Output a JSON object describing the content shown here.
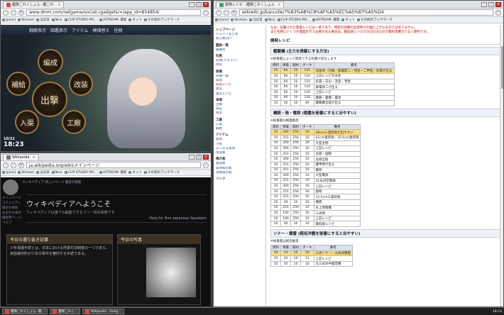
{
  "game_window": {
    "tab": "艦隊これくしょん -艦これ-",
    "url": "www.dmm.com/netgame/social/-/gadgets/=/app_id=854854/",
    "bookmarks": [
      "[pixiv]",
      "Stickam",
      "ほぼ日",
      "Nico",
      "CLIP STUDIO PAI…",
      "USTREAM: 最新",
      "ネット",
      "その他のブックマーク"
    ],
    "menu": [
      "戦績表示",
      "図鑑表示",
      "アイテム",
      "模様替え",
      "任務"
    ],
    "hubs": {
      "center": "出撃",
      "top": "編成",
      "left": "補給",
      "right": "改装",
      "bottom_left": "入渠",
      "bottom_right": "工廠"
    },
    "date": "10/22",
    "time": "18:23"
  },
  "wiki_left_window": {
    "tab": "Wikipedia",
    "url": "ja.wikipedia.org/wiki/メインページ",
    "top_links": "ウィキペディア 新しいページ  最近の更新",
    "welcome": "ウィキペディアへようこそ",
    "welcome_sub": "ウィキペディアは誰でも編集できるフリー百科事典です",
    "help_link": "Help for Non-Japanese Speakers",
    "panel1_title": "今日の選り抜き記事",
    "panel1_text": "少年保護手続とは、日本における刑事司法制度の一つであり、家庭裁判所が少年の事件を審判する手続である。",
    "panel2_title": "今日の写真",
    "side": [
      "メインページ",
      "コミュニティ",
      "最近の更新",
      "おまかせ表示",
      "練習用ページ",
      "ヘルプ"
    ]
  },
  "wiki_right_window": {
    "tab": "開発レシピ - 艦隊これくしょん",
    "url": "wikiwiki.jp/kancolle/?%B3%AB%C8%AF%A5%EC%A5%B7%A5%D4",
    "notice1": "なお、記載された開発レシピは一例であり、特定の装備の出現率が大幅に上がるものではありません。",
    "notice2": "また任務にいくつか開発を行う必要がある場合は、最低値レシピ(10/10/10/10)が資材消費が少なく便利です。",
    "page_title": "開発レシピ",
    "nav": [
      {
        "t": "トップページ",
        "c": "hd"
      },
      {
        "t": "ドロップまとめ",
        "c": "a"
      },
      {
        "t": "初心者向け",
        "c": "a"
      },
      {
        "t": "艦娘一覧",
        "c": "hd"
      },
      {
        "t": "艦種別",
        "c": "a"
      },
      {
        "t": "任務",
        "c": "hd"
      },
      {
        "t": "任務(クエスト)",
        "c": "a"
      },
      {
        "t": "改装",
        "c": "a"
      },
      {
        "t": "装備",
        "c": "hd"
      },
      {
        "t": "装備一覧",
        "c": "a"
      },
      {
        "t": "開発",
        "c": "a"
      },
      {
        "t": "開発レシピ",
        "c": "red"
      },
      {
        "t": "建造",
        "c": "a"
      },
      {
        "t": "建造レシピ",
        "c": "a"
      },
      {
        "t": "海域",
        "c": "hd"
      },
      {
        "t": "出撃",
        "c": "a"
      },
      {
        "t": "遠征",
        "c": "a"
      },
      {
        "t": "演習",
        "c": "a"
      },
      {
        "t": "工廠",
        "c": "hd"
      },
      {
        "t": "入渠",
        "c": "a"
      },
      {
        "t": "補給",
        "c": "a"
      },
      {
        "t": "アイテム",
        "c": "hd"
      },
      {
        "t": "家具",
        "c": "a"
      },
      {
        "t": "小技",
        "c": "a"
      },
      {
        "t": "よくある質問",
        "c": "a"
      },
      {
        "t": "用語集",
        "c": "a"
      },
      {
        "t": "掲示板",
        "c": "hd"
      },
      {
        "t": "雑談板",
        "c": "a"
      },
      {
        "t": "質問掲示板",
        "c": "a"
      },
      {
        "t": "攻略掲示板",
        "c": "a"
      },
      {
        "t": "リンク",
        "c": "hd"
      }
    ],
    "section1": "艦載機 (主力を搭載にする方法)",
    "note1": "※秘書艦によって開発できる装備が変化します",
    "headers": [
      "燃料",
      "弾薬",
      "鋼材",
      "ボーキ",
      "備考"
    ],
    "table1": [
      {
        "v": [
          "20",
          "60",
          "10",
          "110"
        ],
        "note": "流星改・烈風・紫電改二・彗星一二甲型・彩雲が出る",
        "hl": true
      },
      {
        "v": [
          "20",
          "60",
          "10",
          "110"
        ],
        "note": "上記レシピの派生",
        "hl": false
      },
      {
        "v": [
          "20",
          "60",
          "10",
          "110"
        ],
        "note": "彩雲・天山・流星・彗星",
        "hl": false
      },
      {
        "v": [
          "20",
          "60",
          "10",
          "110"
        ],
        "note": "紫電改二が出る",
        "hl": false
      },
      {
        "v": [
          "20",
          "60",
          "10",
          "110"
        ],
        "note": "上記レシピ",
        "hl": false
      },
      {
        "v": [
          "30",
          "60",
          "10",
          "120"
        ],
        "note": "艦戦・艦爆・艦攻",
        "hl": false
      },
      {
        "v": [
          "10",
          "30",
          "10",
          "40"
        ],
        "note": "艦載機全般が出る",
        "hl": false
      }
    ],
    "section2": "機銃・砲・電探 (戦艦を秘書にすると出やすい)",
    "note2": "※秘書艦は戦艦推奨",
    "table2": [
      {
        "v": [
          "10",
          "300",
          "250",
          "10"
        ],
        "note": "46cm三連装砲が出やすい",
        "hl": true
      },
      {
        "v": [
          "10",
          "251",
          "250",
          "10"
        ],
        "note": "41cm連装砲・35.6cm連装砲",
        "hl": false
      },
      {
        "v": [
          "10",
          "300",
          "250",
          "30"
        ],
        "note": "大型主砲",
        "hl": false
      },
      {
        "v": [
          "10",
          "300",
          "250",
          "10"
        ],
        "note": "上記レシピ",
        "hl": false
      },
      {
        "v": [
          "10",
          "251",
          "250",
          "10"
        ],
        "note": "主砲・副砲",
        "hl": false
      },
      {
        "v": [
          "10",
          "300",
          "250",
          "10"
        ],
        "note": "主砲全般",
        "hl": false
      },
      {
        "v": [
          "10",
          "251",
          "250",
          "10"
        ],
        "note": "徹甲弾が出る",
        "hl": false
      },
      {
        "v": [
          "10",
          "251",
          "250",
          "10"
        ],
        "note": "電探",
        "hl": false
      },
      {
        "v": [
          "10",
          "300",
          "250",
          "10"
        ],
        "note": "大型電探",
        "hl": false
      },
      {
        "v": [
          "10",
          "251",
          "250",
          "10"
        ],
        "note": "21号対空電探",
        "hl": false
      },
      {
        "v": [
          "10",
          "300",
          "250",
          "10"
        ],
        "note": "上記レシピ",
        "hl": false
      },
      {
        "v": [
          "10",
          "251",
          "250",
          "30"
        ],
        "note": "副砲",
        "hl": false
      },
      {
        "v": [
          "10",
          "251",
          "250",
          "10"
        ],
        "note": "15.5cm三連装砲",
        "hl": false
      },
      {
        "v": [
          "10",
          "30",
          "10",
          "10"
        ],
        "note": "機銃",
        "hl": false
      },
      {
        "v": [
          "10",
          "251",
          "250",
          "10"
        ],
        "note": "水上偵察機",
        "hl": false
      },
      {
        "v": [
          "10",
          "100",
          "250",
          "10"
        ],
        "note": "三式弾",
        "hl": false
      },
      {
        "v": [
          "10",
          "100",
          "250",
          "10"
        ],
        "note": "上記レシピ",
        "hl": false
      },
      {
        "v": [
          "10",
          "30",
          "10",
          "10"
        ],
        "note": "最低値レシピ",
        "hl": false
      }
    ],
    "section3": "ソナー・爆雷 (軽巡洋艦を秘書にすると出やすい)",
    "note3": "※秘書艦は軽巡推奨",
    "table3": [
      {
        "v": [
          "10",
          "10",
          "10",
          "20"
        ],
        "note": "三式ソナー・九四式爆雷",
        "hl": true
      },
      {
        "v": [
          "10",
          "10",
          "10",
          "11"
        ],
        "note": "上記レシピ",
        "hl": false
      },
      {
        "v": [
          "10",
          "30",
          "10",
          "10"
        ],
        "note": "九三式水中聴音機",
        "hl": false
      }
    ]
  },
  "taskbar": {
    "items": [
      "艦隊これくしょん -艦…",
      "艦隊これく…",
      "Wikipedia - Goog…"
    ],
    "clock": "18:23"
  }
}
